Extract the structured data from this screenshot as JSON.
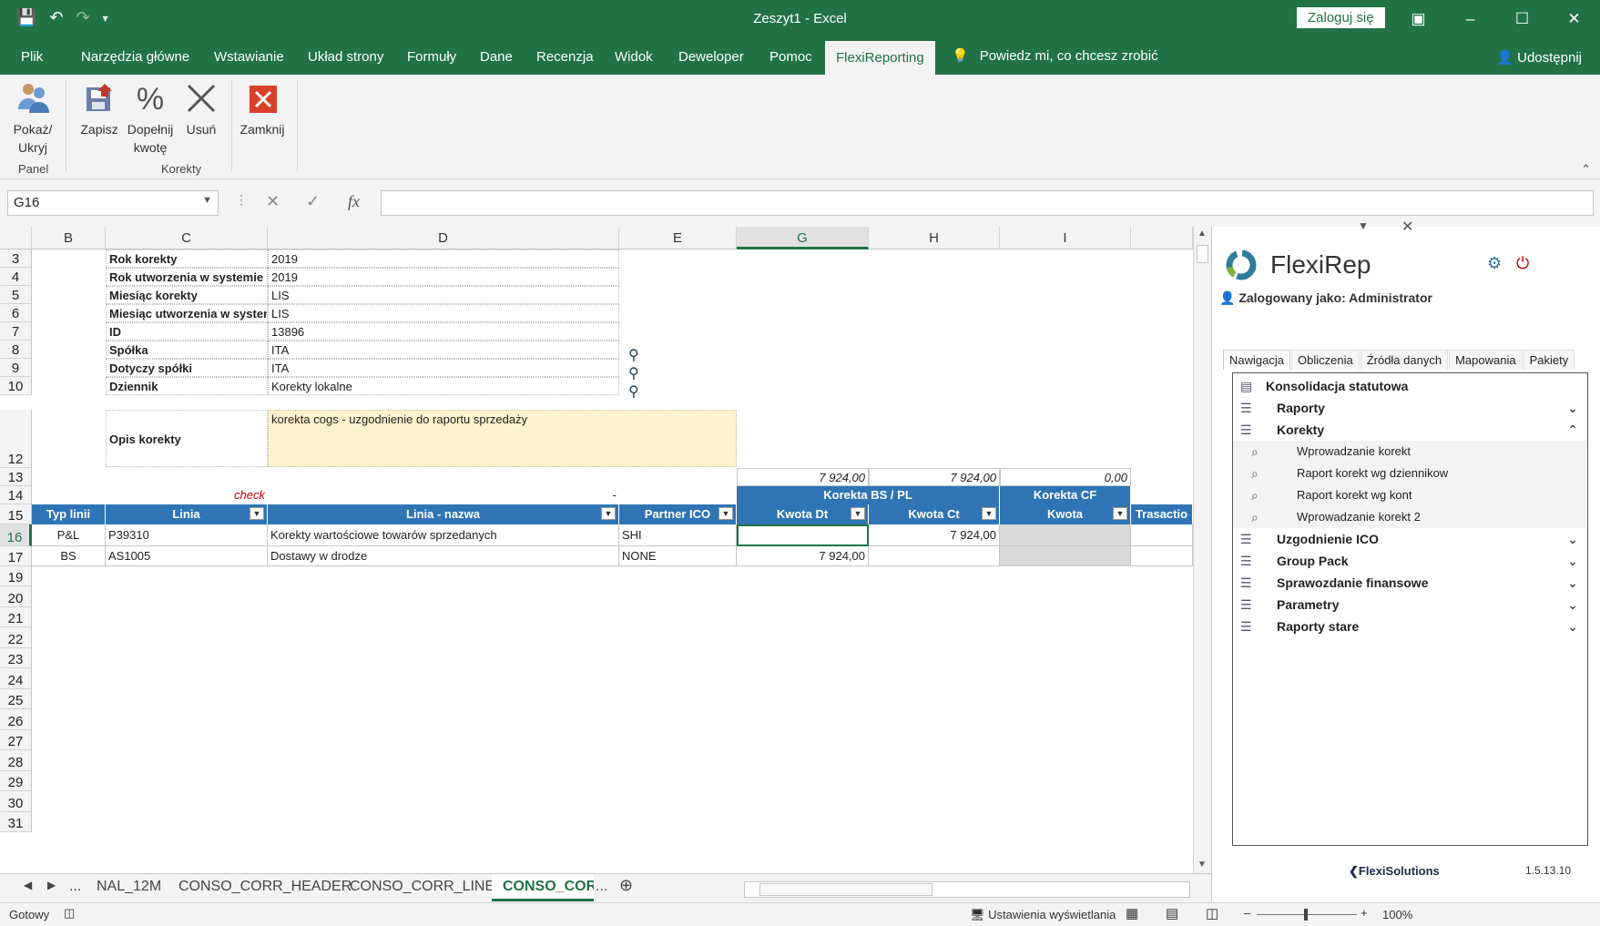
{
  "window": {
    "title": "Zeszyt1  -  Excel",
    "signin": "Zaloguj się"
  },
  "tabs": [
    "Plik",
    "Narzędzia główne",
    "Wstawianie",
    "Układ strony",
    "Formuły",
    "Dane",
    "Recenzja",
    "Widok",
    "Deweloper",
    "Pomoc",
    "FlexiReporting"
  ],
  "tellme": "Powiedz mi, co chcesz zrobić",
  "share": "Udostępnij",
  "ribbon": {
    "pokaz": "Pokaż/\nUkryj",
    "zapisz": "Zapisz",
    "dopelnij": "Dopełnij\nkwotę",
    "usun": "Usuń",
    "zamknij": "Zamknij",
    "group_panel": "Panel",
    "group_korekty": "Korekty"
  },
  "namebox": "G16",
  "columns": [
    "B",
    "C",
    "D",
    "E",
    "G",
    "H",
    "I"
  ],
  "rows": [
    "3",
    "4",
    "5",
    "6",
    "7",
    "8",
    "9",
    "10",
    "12",
    "13",
    "14",
    "15",
    "16",
    "17",
    "19",
    "20",
    "21",
    "22",
    "23",
    "24",
    "25",
    "26",
    "27",
    "28",
    "29",
    "30",
    "31"
  ],
  "header_fields": [
    {
      "label": "Rok korekty",
      "value": "2019"
    },
    {
      "label": "Rok utworzenia w systemie",
      "value": "2019"
    },
    {
      "label": "Miesiąc korekty",
      "value": "LIS"
    },
    {
      "label": "Miesiąc utworzenia w systemie",
      "value": "LIS"
    },
    {
      "label": "ID",
      "value": "13896"
    },
    {
      "label": "Spółka",
      "value": "ITA"
    },
    {
      "label": "Dotyczy spółki",
      "value": "ITA"
    },
    {
      "label": "Dziennik",
      "value": "Korekty lokalne"
    }
  ],
  "opis": {
    "label": "Opis korekty",
    "value": "korekta cogs - uzgodnienie do raportu sprzedaży"
  },
  "sums": {
    "g": "7 924,00",
    "h": "7 924,00",
    "i": "0,00"
  },
  "check": "check",
  "dash": "-",
  "group_headers": {
    "bspl": "Korekta BS / PL",
    "cf": "Korekta CF"
  },
  "table_headers": [
    "Typ linii",
    "Linia",
    "Linia - nazwa",
    "Partner ICO",
    "Kwota Dt",
    "Kwota Ct",
    "Kwota",
    "Trasactio"
  ],
  "table_rows": [
    {
      "typ": "P&L",
      "linia": "P39310",
      "nazwa": "Korekty wartościowe towarów sprzedanych",
      "partner": "SHI",
      "dt": "",
      "ct": "7 924,00"
    },
    {
      "typ": "BS",
      "linia": "AS1005",
      "nazwa": "Dostawy w drodze",
      "partner": "NONE",
      "dt": "7 924,00",
      "ct": ""
    }
  ],
  "sheets": [
    "NAL_12M",
    "CONSO_CORR_HEADER",
    "CONSO_CORR_LINES",
    "CONSO_CORR"
  ],
  "ellipsis": "...",
  "status": {
    "ready": "Gotowy",
    "display": "Ustawienia wyświetlania",
    "zoom": "100%"
  },
  "pane": {
    "title": "FlexiRep",
    "logged": "Zalogowany jako: Administrator",
    "tabs": [
      "Nawigacja",
      "Obliczenia",
      "Źródła danych",
      "Mapowania",
      "Pakiety"
    ],
    "root": "Konsolidacja statutowa",
    "items": [
      {
        "label": "Raporty",
        "level": 1,
        "open": false
      },
      {
        "label": "Korekty",
        "level": 1,
        "open": true
      },
      {
        "label": "Wprowadzanie korekt",
        "level": 2
      },
      {
        "label": "Raport korekt wg dziennikow",
        "level": 2
      },
      {
        "label": "Raport korekt wg kont",
        "level": 2
      },
      {
        "label": "Wprowadzanie korekt 2",
        "level": 2
      },
      {
        "label": "Uzgodnienie ICO",
        "level": 1,
        "open": false
      },
      {
        "label": "Group Pack",
        "level": 1,
        "open": false
      },
      {
        "label": "Sprawozdanie finansowe",
        "level": 1,
        "open": false
      },
      {
        "label": "Parametry",
        "level": 1,
        "open": false
      },
      {
        "label": "Raporty stare",
        "level": 1,
        "open": false
      }
    ],
    "brand": "FlexiSolutions",
    "version": "1.5.13.10"
  }
}
